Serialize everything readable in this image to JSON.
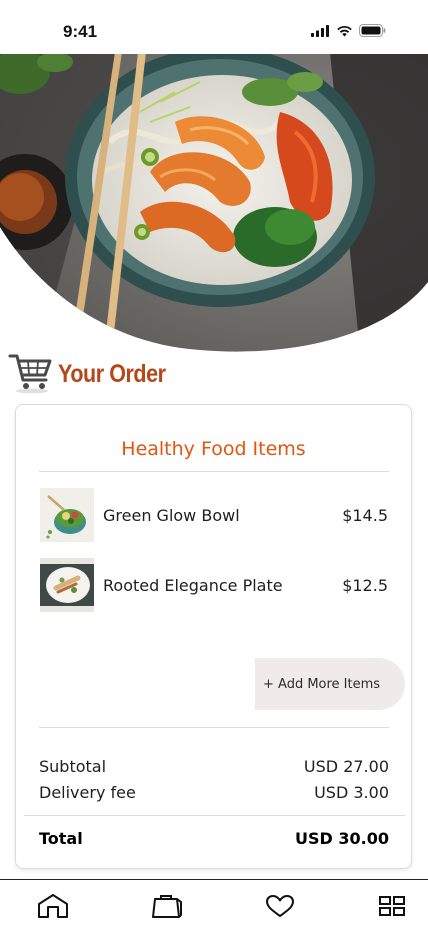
{
  "status_bar": {
    "time": "9:41",
    "icons": [
      "signal-icon",
      "wifi-icon",
      "battery-icon"
    ]
  },
  "hero": {
    "image": "shrimp-bowl-photo"
  },
  "order": {
    "title": "Your Order",
    "icon": "shopping-cart-icon",
    "accent_color": "#b5471a"
  },
  "card": {
    "title": "Healthy Food Items",
    "title_color": "#e0560f",
    "items": [
      {
        "name": "Green Glow Bowl",
        "price": "$14.5",
        "thumb": "green-glow-bowl-photo"
      },
      {
        "name": "Rooted Elegance Plate",
        "price": "$12.5",
        "thumb": "rooted-elegance-plate-photo"
      }
    ],
    "add_more_label": "+ Add More Items",
    "subtotal_label": "Subtotal",
    "subtotal_value": "USD 27.00",
    "delivery_label": "Delivery fee",
    "delivery_value": "USD 3.00",
    "total_label": "Total",
    "total_value": "USD 30.00"
  },
  "tab_bar": {
    "tabs": [
      "home-icon",
      "shopping-bag-icon",
      "heart-icon",
      "grid-icon"
    ]
  }
}
